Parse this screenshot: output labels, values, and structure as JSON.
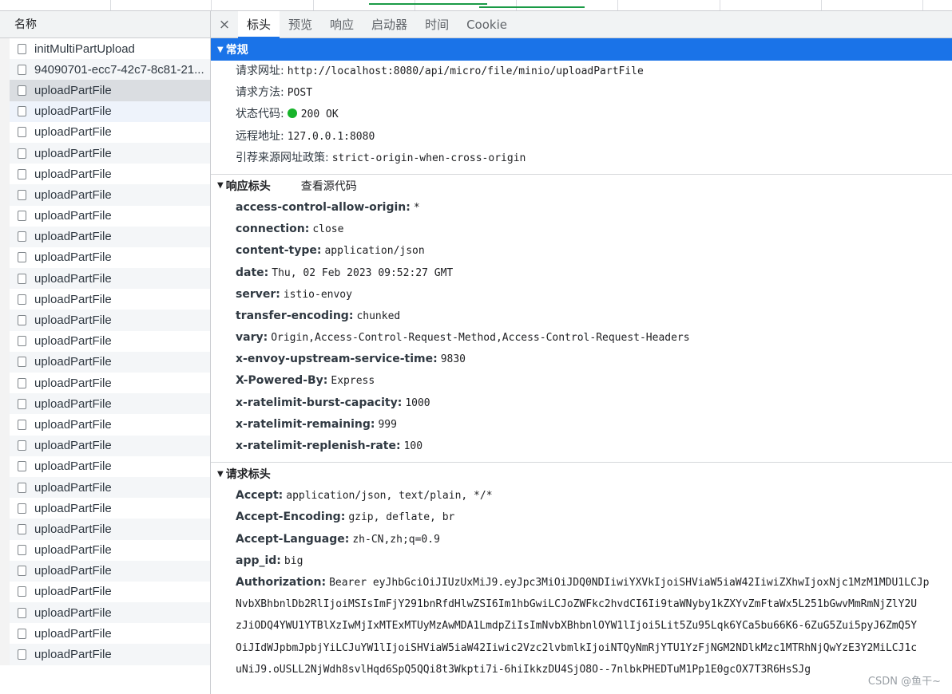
{
  "list_header": "名称",
  "requests": [
    "initMultiPartUpload",
    "94090701-ecc7-42c7-8c81-21...",
    "uploadPartFile",
    "uploadPartFile",
    "uploadPartFile",
    "uploadPartFile",
    "uploadPartFile",
    "uploadPartFile",
    "uploadPartFile",
    "uploadPartFile",
    "uploadPartFile",
    "uploadPartFile",
    "uploadPartFile",
    "uploadPartFile",
    "uploadPartFile",
    "uploadPartFile",
    "uploadPartFile",
    "uploadPartFile",
    "uploadPartFile",
    "uploadPartFile",
    "uploadPartFile",
    "uploadPartFile",
    "uploadPartFile",
    "uploadPartFile",
    "uploadPartFile",
    "uploadPartFile",
    "uploadPartFile",
    "uploadPartFile",
    "uploadPartFile",
    "uploadPartFile"
  ],
  "tabs": [
    "标头",
    "预览",
    "响应",
    "启动器",
    "时间",
    "Cookie"
  ],
  "close_glyph": "×",
  "general": {
    "title": "常规",
    "rows": [
      {
        "k": "请求网址:",
        "v": "http://localhost:8080/api/micro/file/minio/uploadPartFile"
      },
      {
        "k": "请求方法:",
        "v": "POST"
      },
      {
        "k": "状态代码:",
        "v": "200 OK"
      },
      {
        "k": "远程地址:",
        "v": "127.0.0.1:8080"
      },
      {
        "k": "引荐来源网址政策:",
        "v": "strict-origin-when-cross-origin"
      }
    ]
  },
  "response_headers": {
    "title": "响应标头",
    "view_source": "查看源代码",
    "rows": [
      {
        "k": "access-control-allow-origin:",
        "v": "*"
      },
      {
        "k": "connection:",
        "v": "close"
      },
      {
        "k": "content-type:",
        "v": "application/json"
      },
      {
        "k": "date:",
        "v": "Thu, 02 Feb 2023 09:52:27 GMT"
      },
      {
        "k": "server:",
        "v": "istio-envoy"
      },
      {
        "k": "transfer-encoding:",
        "v": "chunked"
      },
      {
        "k": "vary:",
        "v": "Origin,Access-Control-Request-Method,Access-Control-Request-Headers"
      },
      {
        "k": "x-envoy-upstream-service-time:",
        "v": "9830"
      },
      {
        "k": "X-Powered-By:",
        "v": "Express"
      },
      {
        "k": "x-ratelimit-burst-capacity:",
        "v": "1000"
      },
      {
        "k": "x-ratelimit-remaining:",
        "v": "999"
      },
      {
        "k": "x-ratelimit-replenish-rate:",
        "v": "100"
      }
    ]
  },
  "request_headers": {
    "title": "请求标头",
    "rows": [
      {
        "k": "Accept:",
        "v": "application/json, text/plain, */*"
      },
      {
        "k": "Accept-Encoding:",
        "v": "gzip, deflate, br"
      },
      {
        "k": "Accept-Language:",
        "v": "zh-CN,zh;q=0.9"
      },
      {
        "k": "app_id:",
        "v": "big"
      },
      {
        "k": "Authorization:",
        "v": "Bearer eyJhbGciOiJIUzUxMiJ9.eyJpc3MiOiJDQ0NDIiwiYXVkIjoiSHViaW5iaW42IiwiZXhwIjoxNjc1MzM1MDU1LCJp"
      }
    ],
    "auth_continuation": [
      "NvbXBhbnlDb2RlIjoiMSIsImFjY291bnRfdHlwZSI6Im1hbGwiLCJoZWFkc2hvdCI6Ii9taWNyby1kZXYvZmFtaWx5L251bGwvMmRmNjZlY2U",
      "zJiODQ4YWU1YTBlXzIwMjIxMTExMTUyMzAwMDA1LmdpZiIsImNvbXBhbnlOYW1lIjoi5Lit5Zu95Lqk6YCa5bu66K6-6ZuG5Zui5pyJ6ZmQ5Y",
      "OiJIdWJpbmJpbjYiLCJuYW1lIjoiSHViaW5iaW42Iiwic2Vzc2lvbmlkIjoiNTQyNmRjYTU1YzFjNGM2NDlkMzc1MTRhNjQwYzE3Y2MiLCJ1c",
      "uNiJ9.oUSLL2NjWdh8svlHqd6SpQ5QQi8t3Wkpti7i-6hiIkkzDU4SjO8O--7nlbkPHEDTuM1Pp1E0gcOX7T3R6HsSJg"
    ]
  },
  "watermark": "CSDN @鱼干~"
}
